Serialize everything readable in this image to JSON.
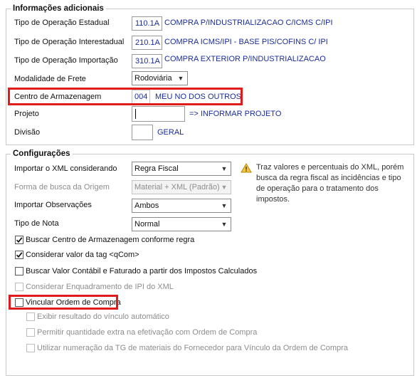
{
  "info": {
    "title": "Informações adicionais",
    "rows": [
      {
        "label": "Tipo de Operação Estadual",
        "code": "110.1A",
        "desc": "COMPRA P/INDUSTRIALIZACAO C/ICMS C/IPI"
      },
      {
        "label": "Tipo de Operação Interestadual",
        "code": "210.1A",
        "desc": "COMPRA ICMS/IPI - BASE PIS/COFINS C/ IPI"
      },
      {
        "label": "Tipo de Operação Importação",
        "code": "310.1A",
        "desc": "COMPRA EXTERIOR  P/INDUSTRIALIZACAO"
      }
    ],
    "frete_label": "Modalidade de Frete",
    "frete_value": "Rodoviária",
    "armazenagem_label": "Centro de Armazenagem",
    "armazenagem_code": "004",
    "armazenagem_desc": "MEU NO DOS OUTROS",
    "projeto_label": "Projeto",
    "projeto_value": "",
    "projeto_link": "=> INFORMAR PROJETO",
    "divisao_label": "Divisão",
    "divisao_value": "",
    "divisao_desc": "GERAL"
  },
  "config": {
    "title": "Configurações",
    "importar_label": "Importar o XML considerando",
    "importar_value": "Regra Fiscal",
    "forma_label": "Forma de busca da Origem",
    "forma_value": "Material + XML (Padrão)",
    "obs_label": "Importar Observações",
    "obs_value": "Ambos",
    "nota_label": "Tipo de Nota",
    "nota_value": "Normal",
    "warning": "Traz valores e percentuais do XML, porém busca da regra fiscal as incidências e tipo de operação para o tratamento dos impostos.",
    "checkboxes": [
      {
        "label": "Buscar Centro de Armazenagem conforme regra",
        "checked": true,
        "enabled": true
      },
      {
        "label": "Considerar valor da tag <qCom>",
        "checked": true,
        "enabled": true
      },
      {
        "label": "Buscar Valor Contábil e Faturado a partir dos Impostos Calculados",
        "checked": false,
        "enabled": true
      },
      {
        "label": "Considerar Enquadramento de IPI do XML",
        "checked": false,
        "enabled": false
      },
      {
        "label": "Vincular Ordem de Compra",
        "checked": false,
        "enabled": true
      },
      {
        "label": "Exibir resultado do vínculo automático",
        "checked": false,
        "enabled": false
      },
      {
        "label": "Permitir quantidade extra na efetivação com Ordem de Compra",
        "checked": false,
        "enabled": false
      },
      {
        "label": "Utilizar numeração da TG de materiais do Fornecedor para Vínculo da Ordem de Compra",
        "checked": false,
        "enabled": false
      }
    ]
  }
}
